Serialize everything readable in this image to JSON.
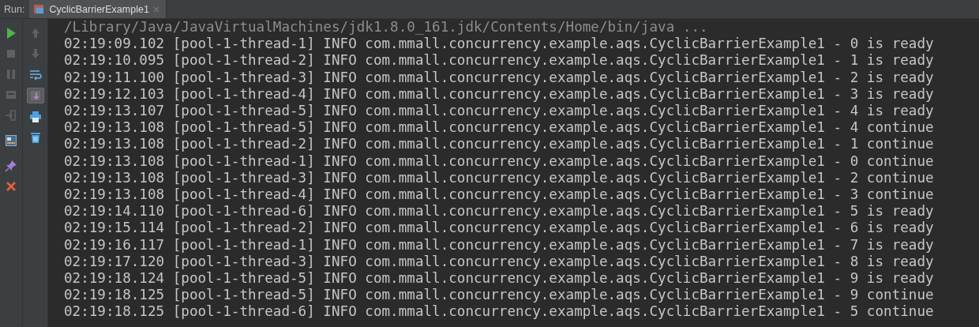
{
  "run_panel": {
    "label": "Run:",
    "tab": {
      "title": "CyclicBarrierExample1",
      "selected": true
    }
  },
  "toolbar_left": [
    {
      "kind": "run",
      "disabled": false
    },
    {
      "kind": "stop",
      "disabled": true
    },
    {
      "kind": "pause",
      "disabled": true
    },
    {
      "kind": "dump",
      "disabled": true
    },
    {
      "kind": "exit",
      "disabled": true
    },
    {
      "kind": "layout",
      "disabled": false
    },
    {
      "kind": "pin",
      "disabled": false
    },
    {
      "kind": "close",
      "disabled": false
    }
  ],
  "toolbar_right": [
    {
      "kind": "up",
      "selected": false,
      "disabled": true
    },
    {
      "kind": "down",
      "selected": false,
      "disabled": true
    },
    {
      "kind": "wrap",
      "selected": false,
      "disabled": false
    },
    {
      "kind": "scroll-end",
      "selected": true,
      "disabled": false
    },
    {
      "kind": "print",
      "selected": false,
      "disabled": false
    },
    {
      "kind": "trash",
      "selected": false,
      "disabled": false
    }
  ],
  "console_lines": [
    {
      "kind": "command",
      "text": "/Library/Java/JavaVirtualMachines/jdk1.8.0_161.jdk/Contents/Home/bin/java ..."
    },
    {
      "kind": "log",
      "text": "02:19:09.102 [pool-1-thread-1] INFO com.mmall.concurrency.example.aqs.CyclicBarrierExample1 - 0 is ready"
    },
    {
      "kind": "log",
      "text": "02:19:10.095 [pool-1-thread-2] INFO com.mmall.concurrency.example.aqs.CyclicBarrierExample1 - 1 is ready"
    },
    {
      "kind": "log",
      "text": "02:19:11.100 [pool-1-thread-3] INFO com.mmall.concurrency.example.aqs.CyclicBarrierExample1 - 2 is ready"
    },
    {
      "kind": "log",
      "text": "02:19:12.103 [pool-1-thread-4] INFO com.mmall.concurrency.example.aqs.CyclicBarrierExample1 - 3 is ready"
    },
    {
      "kind": "log",
      "text": "02:19:13.107 [pool-1-thread-5] INFO com.mmall.concurrency.example.aqs.CyclicBarrierExample1 - 4 is ready"
    },
    {
      "kind": "log",
      "text": "02:19:13.108 [pool-1-thread-5] INFO com.mmall.concurrency.example.aqs.CyclicBarrierExample1 - 4 continue"
    },
    {
      "kind": "log",
      "text": "02:19:13.108 [pool-1-thread-2] INFO com.mmall.concurrency.example.aqs.CyclicBarrierExample1 - 1 continue"
    },
    {
      "kind": "log",
      "text": "02:19:13.108 [pool-1-thread-1] INFO com.mmall.concurrency.example.aqs.CyclicBarrierExample1 - 0 continue"
    },
    {
      "kind": "log",
      "text": "02:19:13.108 [pool-1-thread-3] INFO com.mmall.concurrency.example.aqs.CyclicBarrierExample1 - 2 continue"
    },
    {
      "kind": "log",
      "text": "02:19:13.108 [pool-1-thread-4] INFO com.mmall.concurrency.example.aqs.CyclicBarrierExample1 - 3 continue"
    },
    {
      "kind": "log",
      "text": "02:19:14.110 [pool-1-thread-6] INFO com.mmall.concurrency.example.aqs.CyclicBarrierExample1 - 5 is ready"
    },
    {
      "kind": "log",
      "text": "02:19:15.114 [pool-1-thread-2] INFO com.mmall.concurrency.example.aqs.CyclicBarrierExample1 - 6 is ready"
    },
    {
      "kind": "log",
      "text": "02:19:16.117 [pool-1-thread-1] INFO com.mmall.concurrency.example.aqs.CyclicBarrierExample1 - 7 is ready"
    },
    {
      "kind": "log",
      "text": "02:19:17.120 [pool-1-thread-3] INFO com.mmall.concurrency.example.aqs.CyclicBarrierExample1 - 8 is ready"
    },
    {
      "kind": "log",
      "text": "02:19:18.124 [pool-1-thread-5] INFO com.mmall.concurrency.example.aqs.CyclicBarrierExample1 - 9 is ready"
    },
    {
      "kind": "log",
      "text": "02:19:18.125 [pool-1-thread-5] INFO com.mmall.concurrency.example.aqs.CyclicBarrierExample1 - 9 continue"
    },
    {
      "kind": "log",
      "text": "02:19:18.125 [pool-1-thread-6] INFO com.mmall.concurrency.example.aqs.CyclicBarrierExample1 - 5 continue"
    }
  ]
}
